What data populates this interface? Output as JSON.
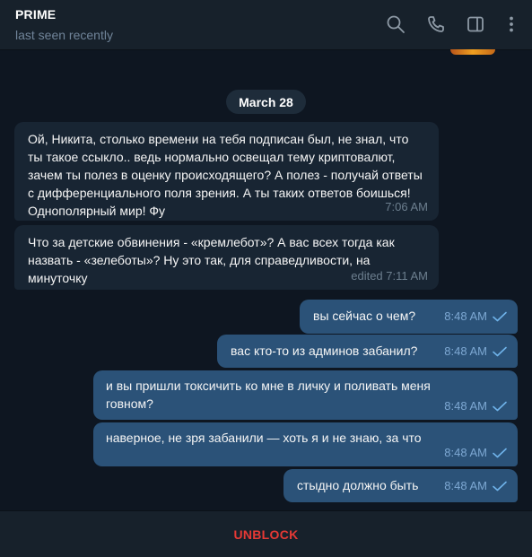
{
  "header": {
    "name": "PRIME",
    "status": "last seen recently",
    "icons": [
      "search-icon",
      "phone-icon",
      "sidebar-toggle-icon",
      "more-icon"
    ]
  },
  "chat": {
    "date_separator": "March 28",
    "messages": [
      {
        "direction": "incoming",
        "text": "Ой, Никита, столько времени на тебя подписан был, не знал, что ты такое ссыкло.. ведь нормально освещал тему криптовалют, зачем ты полез в оценку происходящего? А полез - получай ответы с дифференциального поля зрения. А ты таких ответов боишься! Однополярный мир! Фу",
        "time": "7:06 AM"
      },
      {
        "direction": "incoming",
        "text": "Что за детские обвинения - «кремлебот»? А вас всех тогда как назвать - «зелеботы»? Ну это так, для справедливости, на минуточку",
        "time": "edited 7:11 AM"
      },
      {
        "direction": "outgoing",
        "text": "вы сейчас о чем?",
        "time": "8:48 AM",
        "read": true
      },
      {
        "direction": "outgoing",
        "text": "вас кто-то из админов забанил?",
        "time": "8:48 AM",
        "read": true
      },
      {
        "direction": "outgoing",
        "text": "и вы пришли токсичить ко мне в личку и поливать меня говном?",
        "time": "8:48 AM",
        "read": true
      },
      {
        "direction": "outgoing",
        "text": "наверное, не зря забанили — хоть я и не знаю, за что",
        "time": "8:48 AM",
        "read": true
      },
      {
        "direction": "outgoing",
        "text": "стыдно должно быть",
        "time": "8:48 AM",
        "read": true
      }
    ]
  },
  "footer": {
    "action_label": "UNBLOCK"
  },
  "colors": {
    "background": "#0e1621",
    "header": "#17212b",
    "incoming_bubble": "#182533",
    "outgoing_bubble": "#2b5278",
    "unblock": "#e53935"
  }
}
